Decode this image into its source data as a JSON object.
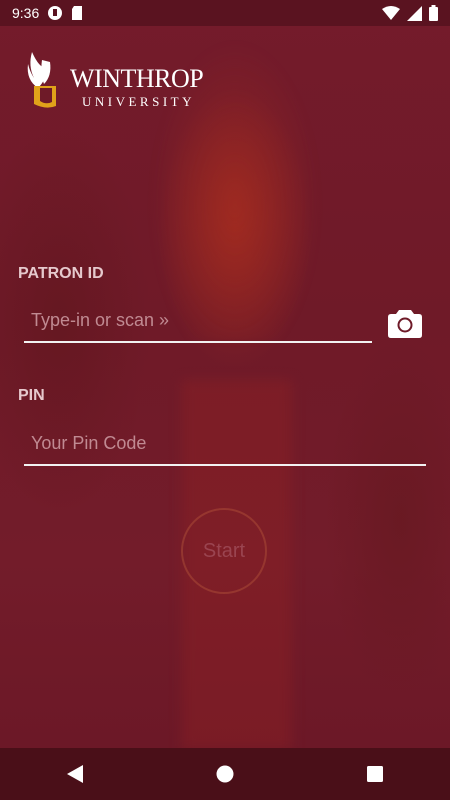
{
  "status_bar": {
    "time": "9:36",
    "icons": [
      "pocket-icon",
      "sd-card-icon",
      "wifi-icon",
      "signal-icon",
      "battery-icon"
    ]
  },
  "logo": {
    "name": "WINTHROP",
    "subtitle": "UNIVERSITY"
  },
  "patron_id": {
    "label": "PATRON ID",
    "placeholder": "Type-in or scan »",
    "value": "",
    "scan_icon": "camera-icon"
  },
  "pin": {
    "label": "PIN",
    "placeholder": "Your Pin Code",
    "value": ""
  },
  "start_button": {
    "label": "Start"
  },
  "nav_bar": {
    "icons": [
      "back-icon",
      "home-icon",
      "recents-icon"
    ]
  },
  "colors": {
    "background": "#6e1a28",
    "label": "#e6c9cd",
    "logo_gold": "#e0a21a",
    "input_line": "#f2f2f2"
  }
}
